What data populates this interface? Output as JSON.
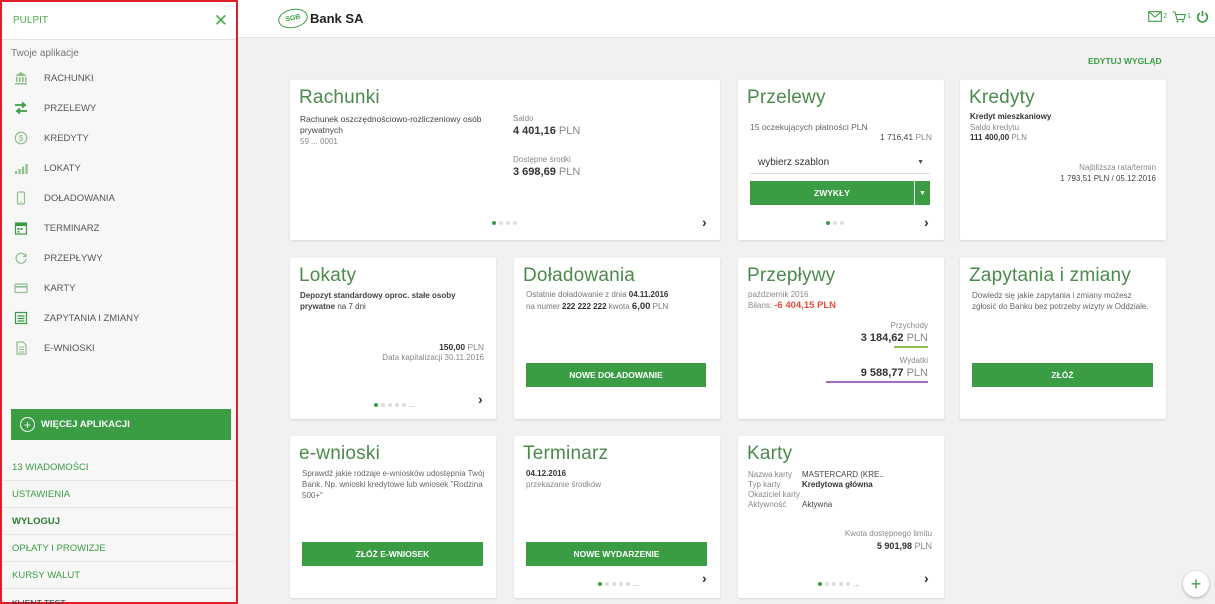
{
  "sidebar": {
    "title": "PULPIT",
    "apps_title": "Twoje aplikacje",
    "items": [
      {
        "label": "RACHUNKI",
        "icon": "bank-icon"
      },
      {
        "label": "PRZELEWY",
        "icon": "transfer-arrows-icon"
      },
      {
        "label": "KREDYTY",
        "icon": "currency-coin-icon"
      },
      {
        "label": "LOKATY",
        "icon": "bar-growth-icon"
      },
      {
        "label": "DOŁADOWANIA",
        "icon": "phone-icon"
      },
      {
        "label": "TERMINARZ",
        "icon": "calendar-icon"
      },
      {
        "label": "PRZEPŁYWY",
        "icon": "flow-icon"
      },
      {
        "label": "KARTY",
        "icon": "card-icon"
      },
      {
        "label": "ZAPYTANIA I ZMIANY",
        "icon": "list-icon"
      },
      {
        "label": "E-WNIOSKI",
        "icon": "document-icon"
      }
    ],
    "more_apps": "WIĘCEJ APLIKACJI",
    "links": {
      "messages": "13 WIADOMOŚCI",
      "settings": "USTAWIENIA",
      "logout": "WYLOGUJ",
      "fees": "OPŁATY I PROWIZJE",
      "rates": "KURSY WALUT",
      "client": "KLIENT TEST"
    }
  },
  "header": {
    "logo_mark": "SGB",
    "bank_name": "Bank SA",
    "mail_count": "2",
    "cart_count": "1"
  },
  "edit_layout": "EDYTUJ WYGLĄD",
  "colors": {
    "accent": "#3a9d44",
    "title_green": "#4b8a4b",
    "negative": "#e74c3c",
    "income_bar": "#8bc34a",
    "expense_bar": "#a66bbd",
    "highlight_border": "#e01e2a"
  },
  "cards": {
    "rachunki": {
      "title": "Rachunki",
      "account_name": "Rachunek oszczędnościowo-rozliczeniowy osób prywatnych",
      "account_no": "59 ... 0001",
      "saldo_label": "Saldo",
      "saldo": "4 401,16",
      "available_label": "Dostępne środki",
      "available": "3 698,69",
      "currency": "PLN"
    },
    "przelewy": {
      "title": "Przelewy",
      "pending": "15 oczekujących płatności PLN",
      "pending_amount": "1 716,41",
      "currency": "PLN",
      "template_placeholder": "wybierz szablon",
      "regular_button": "ZWYKŁY"
    },
    "kredyty": {
      "title": "Kredyty",
      "name": "Kredyt mieszkaniowy",
      "saldo_label": "Saldo kredytu",
      "saldo": "111 400,00",
      "currency": "PLN",
      "next_label": "Najbliższa rata/termin",
      "next_value": "1 793,51 PLN / 05.12.2016"
    },
    "lokaty": {
      "title": "Lokaty",
      "name_bold": "Depozyt standardowy oproc. stałe osoby prywatne",
      "name_rest": "na 7 dni",
      "amount": "150,00",
      "currency": "PLN",
      "capitalization": "Data kapitalizacji 30.11.2016"
    },
    "doladowania": {
      "title": "Doładowania",
      "line1": "Ostatnie doładowanie z dnia",
      "date": "04.11.2016",
      "line2": "na numer",
      "number": "222 222 222",
      "amount_label": "kwota",
      "amount": "6,00",
      "currency": "PLN",
      "button": "NOWE DOŁADOWANIE"
    },
    "przeplywy": {
      "title": "Przepływy",
      "month": "październik 2016",
      "balance_label": "Bilans:",
      "balance": "-6 404,15 PLN",
      "income_label": "Przychody",
      "income": "3 184,62",
      "expense_label": "Wydatki",
      "expense": "9 588,77",
      "currency": "PLN",
      "income_share": 0.25,
      "expense_share": 0.75
    },
    "zapytania": {
      "title": "Zapytania i zmiany",
      "text": "Dowiedz się jakie zapytania i zmiany możesz zgłosić do Banku bez potrzeby wizyty w Oddziale.",
      "button": "ZŁÓŻ"
    },
    "ewnioski": {
      "title": "e-wnioski",
      "text": "Sprawdź jakie rodzaje e-wniosków udostępnia Twój Bank. Np. wnioski kredytowe lub wniosek \"Rodzina 500+\"",
      "button": "ZŁÓŻ E-WNIOSEK"
    },
    "terminarz": {
      "title": "Terminarz",
      "date": "04.12.2016",
      "item": "przekazanie środków",
      "button": "NOWE WYDARZENIE"
    },
    "karty": {
      "title": "Karty",
      "name_label": "Nazwa karty",
      "name_value": "MASTERCARD (KRE..",
      "type_label": "Typ karty",
      "type_value": "Kredytowa główna",
      "holder_label": "Okaziciel karty",
      "holder_value": "",
      "activity_label": "Aktywność",
      "activity_value": "Aktywna",
      "limit_label": "Kwota dostępnego limitu",
      "limit": "5 901,98",
      "currency": "PLN"
    }
  }
}
